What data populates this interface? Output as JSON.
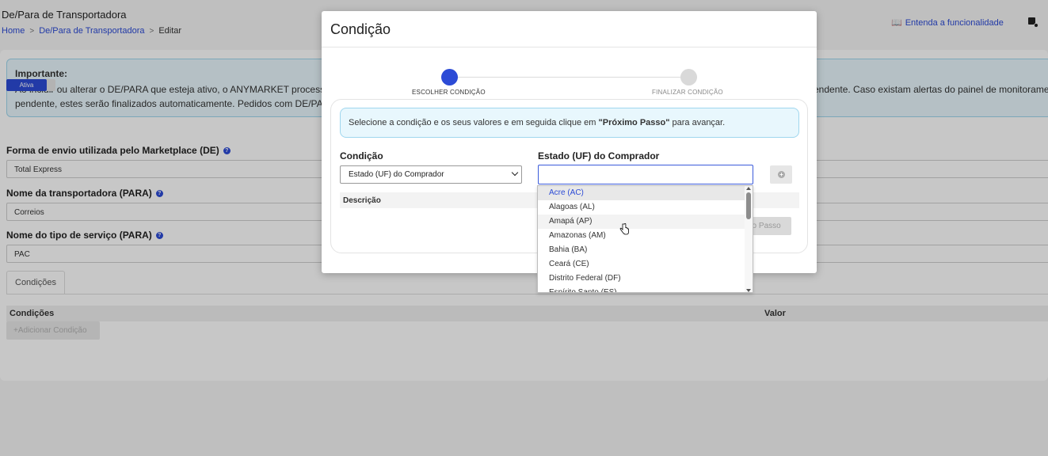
{
  "page": {
    "title": "De/Para de Transportadora",
    "breadcrumb": [
      "Home",
      "De/Para de Transportadora",
      "Editar"
    ],
    "help_link": "Entenda a funcionalidade"
  },
  "alert": {
    "title": "Importante:",
    "line1": "Ao incluir ou alterar o DE/PARA que esteja ativo, o ANYMARKET processará",
    "line1_tail": "endente. Caso existam alertas do painel de monitorame",
    "line2": "pendente, estes serão finalizados automaticamente. Pedidos com DE/PAR"
  },
  "status_toggle": "Ativa",
  "fields": [
    {
      "label": "Forma de envio utilizada pelo Marketplace (DE)",
      "value": "Total Express"
    },
    {
      "label": "Nome da transportadora (PARA)",
      "value": "Correios"
    },
    {
      "label": "Nome do tipo de serviço (PARA)",
      "value": "PAC"
    }
  ],
  "tabs": [
    "Condições"
  ],
  "conditions_table": {
    "headers": [
      "Condições",
      "Valor"
    ],
    "add_button": "+Adicionar Condição"
  },
  "modal": {
    "title": "Condição",
    "steps": [
      "ESCOLHER CONDIÇÃO",
      "FINALIZAR CONDIÇÃO"
    ],
    "info_prefix": "Selecione a condição e os seus valores e em seguida clique em ",
    "info_bold": "\"Próximo Passo\"",
    "info_suffix": " para avançar.",
    "condition_label": "Condição",
    "condition_value": "Estado (UF) do Comprador",
    "uf_label": "Estado (UF) do Comprador",
    "uf_value": "",
    "table_header": "Descrição",
    "next_button": "no Passo"
  },
  "dropdown": {
    "options": [
      "Acre (AC)",
      "Alagoas (AL)",
      "Amapá (AP)",
      "Amazonas (AM)",
      "Bahia (BA)",
      "Ceará (CE)",
      "Distrito Federal (DF)",
      "Espírito Santo (ES)"
    ],
    "selected": "Acre (AC)",
    "hovered": "Amapá (AP)"
  },
  "colors": {
    "accent": "#2c4bd6",
    "info_bg": "#e8f7fd",
    "info_border": "#9fd6ee"
  }
}
